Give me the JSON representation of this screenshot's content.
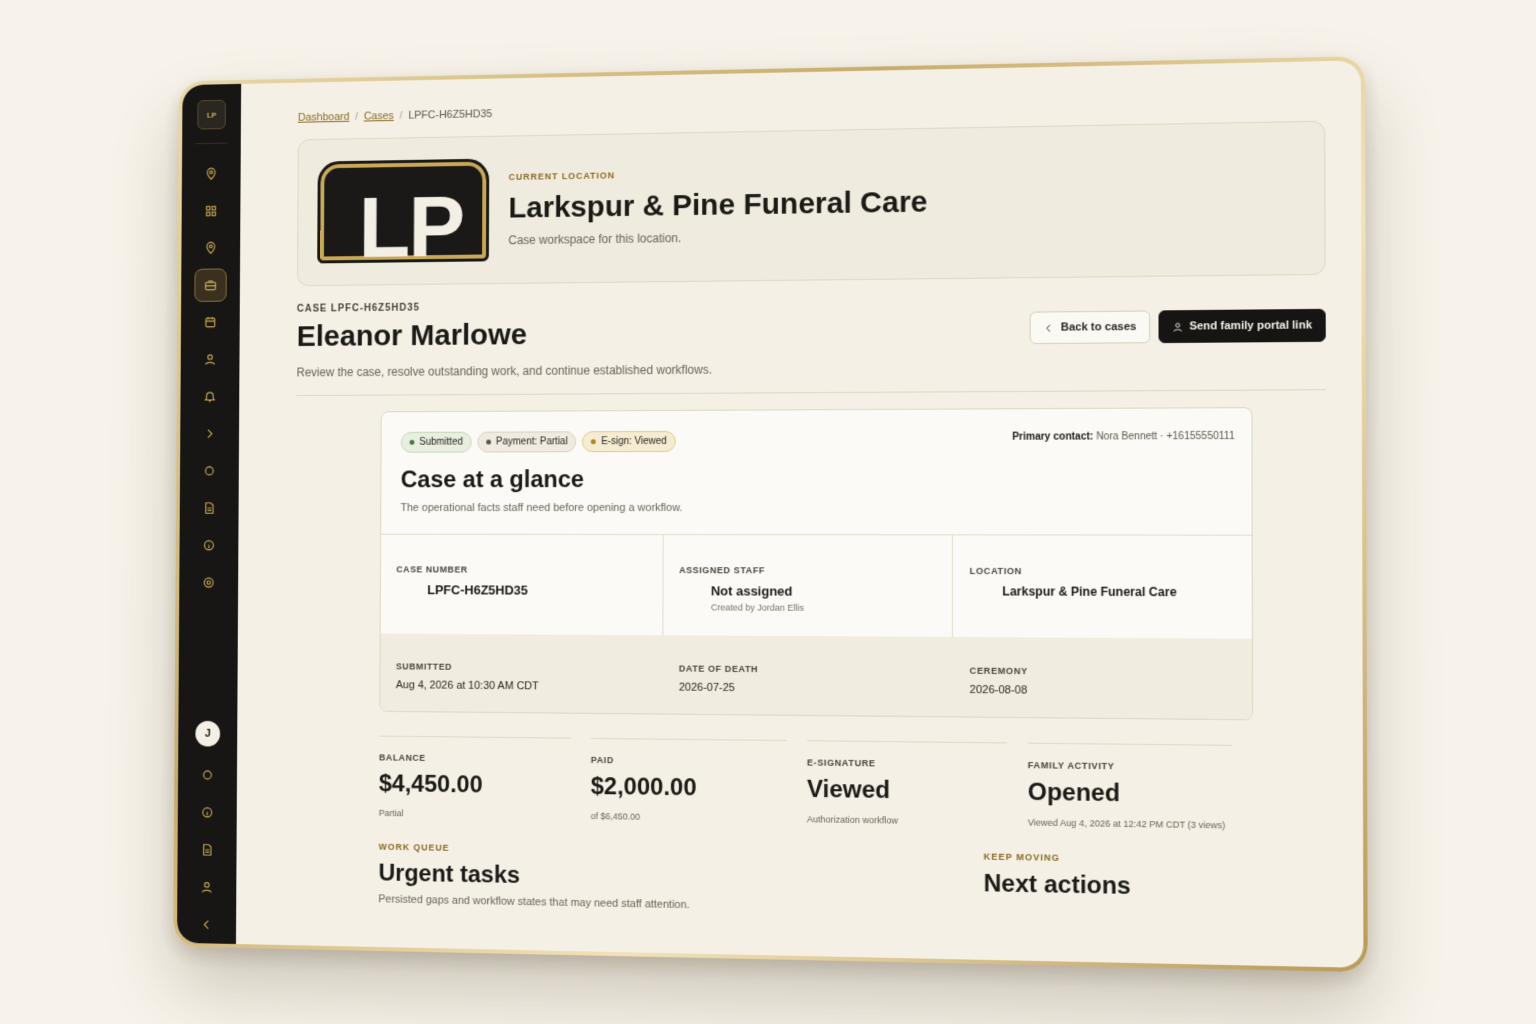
{
  "breadcrumb": {
    "dashboard": "Dashboard",
    "cases": "Cases",
    "current": "LPFC-H6Z5HD35",
    "sep": "/"
  },
  "sidebar": {
    "logo_text": "LP",
    "avatar": "J"
  },
  "location": {
    "eyebrow": "CURRENT LOCATION",
    "name": "Larkspur & Pine Funeral Care",
    "subtitle": "Case workspace for this location.",
    "logo_letters": "LP"
  },
  "case": {
    "id_label": "CASE LPFC-H6Z5HD35",
    "name": "Eleanor Marlowe",
    "description": "Review the case, resolve outstanding work, and continue established workflows."
  },
  "actions": {
    "back": "Back to cases",
    "send": "Send family portal link"
  },
  "glance": {
    "badges": [
      "Submitted",
      "Payment: Partial",
      "E-sign: Viewed"
    ],
    "contact_label": "Primary contact:",
    "contact_value": "Nora Bennett · +16155550111",
    "title": "Case at a glance",
    "subtitle": "The operational facts staff need before opening a workflow.",
    "facts": {
      "case_number_label": "CASE NUMBER",
      "case_number": "LPFC-H6Z5HD35",
      "staff_label": "ASSIGNED STAFF",
      "staff": "Not assigned",
      "staff_sub": "Created by Jordan Ellis",
      "location_label": "LOCATION",
      "location": "Larkspur & Pine Funeral Care"
    },
    "dates": {
      "submitted_label": "SUBMITTED",
      "submitted": "Aug 4, 2026 at 10:30 AM CDT",
      "death_label": "DATE OF DEATH",
      "death": "2026-07-25",
      "ceremony_label": "CEREMONY",
      "ceremony": "2026-08-08"
    }
  },
  "stats": {
    "balance_label": "BALANCE",
    "balance": "$4,450.00",
    "balance_sub": "Partial",
    "paid_label": "PAID",
    "paid": "$2,000.00",
    "paid_sub": "of $6,450.00",
    "esign_label": "E-SIGNATURE",
    "esign": "Viewed",
    "esign_sub": "Authorization workflow",
    "family_label": "FAMILY ACTIVITY",
    "family": "Opened",
    "family_sub": "Viewed Aug 4, 2026 at 12:42 PM CDT (3 views)"
  },
  "work_queue": {
    "eyebrow": "WORK QUEUE",
    "title": "Urgent tasks",
    "subtitle": "Persisted gaps and workflow states that may need staff attention."
  },
  "next_actions": {
    "eyebrow": "KEEP MOVING",
    "title": "Next actions"
  },
  "colors": {
    "accent_gold": "#c9a856",
    "sidebar_bg": "#171614",
    "page_bg": "#f4f0e6"
  }
}
